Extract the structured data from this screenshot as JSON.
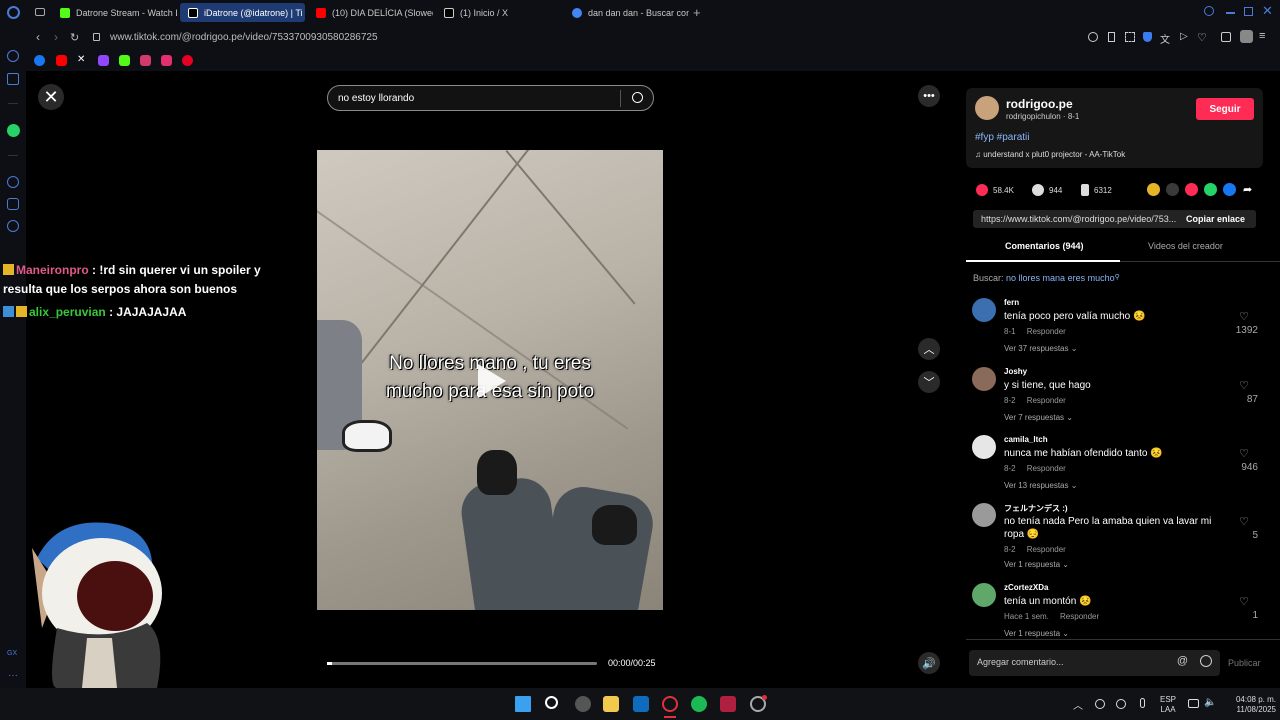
{
  "browser": {
    "tabs": [
      {
        "label": "Datrone Stream - Watch L",
        "color": "#53fc18"
      },
      {
        "label": "iDatrone (@idatrone) | Ti",
        "color": "#000000"
      },
      {
        "label": "(10) DIA DELÍCIA (Slowed",
        "color": "#ff0000"
      },
      {
        "label": "(1) Inicio / X",
        "color": "#ffffff"
      },
      {
        "label": "dan dan dan - Buscar con",
        "color": "#4285f4"
      }
    ],
    "url": "www.tiktok.com/@rodrigoo.pe/video/7533700930580286725"
  },
  "video": {
    "search_text": "no estoy llorando",
    "caption_line1": "No llores mano , tu eres",
    "caption_line2": "mucho para esa sin poto",
    "time": "00:00/00:25",
    "progress": 0.02
  },
  "chat": [
    {
      "user": "Maneironpro",
      "text": ": !rd sin querer vi un spoiler y",
      "text2": "resulta que los serpos ahora son buenos"
    },
    {
      "user": "alix_peruvian",
      "text": ": JAJAJAJAA"
    }
  ],
  "creator": {
    "name": "rodrigoo.pe",
    "handle": "rodrigopichulon · 8-1",
    "follow_label": "Seguir",
    "hashtags": "#fyp #paratii",
    "music": "♫  understand x plut0 projector - AA-TikTok"
  },
  "stats": {
    "likes": "58.4K",
    "comments": "944",
    "saves": "6312"
  },
  "link": {
    "url": "https://www.tiktok.com/@rodrigoo.pe/video/753...",
    "copy_label": "Copiar enlace"
  },
  "tabs": {
    "comments": "Comentarios (944)",
    "videos": "Videos del creador"
  },
  "search_suggest": {
    "prefix": "Buscar:",
    "query": "no llores mana eres mucho"
  },
  "comments": [
    {
      "user": "fern",
      "text": "tenía poco pero valía mucho 😣",
      "date": "8-1",
      "reply": "Responder",
      "replies": "Ver 37 respuestas ⌄",
      "likes": "1392",
      "avatar": "#3a6fb0"
    },
    {
      "user": "Joshy",
      "text": "y si tiene, que hago",
      "date": "8-2",
      "reply": "Responder",
      "replies": "Ver 7 respuestas ⌄",
      "likes": "87",
      "avatar": "#8a6a5a"
    },
    {
      "user": "camila_ltch",
      "text": "nunca me habían ofendido tanto 😣",
      "date": "8-2",
      "reply": "Responder",
      "replies": "Ver 13 respuestas ⌄",
      "likes": "946",
      "avatar": "#e6e6e6"
    },
    {
      "user": "フェルナンデス :)",
      "text": "no tenía nada Pero la amaba quien va lavar mi ropa 😔",
      "date": "8-2",
      "reply": "Responder",
      "replies": "Ver 1 respuesta ⌄",
      "likes": "5",
      "avatar": "#9a9a9a"
    },
    {
      "user": "zCortezXDa",
      "text": "tenía un montón 😣",
      "date": "Hace 1 sem.",
      "reply": "Responder",
      "replies": "Ver 1 respuesta ⌄",
      "likes": "1",
      "avatar": "#5fa86a"
    }
  ],
  "add_comment": {
    "placeholder": "Agregar comentario...",
    "publish": "Publicar"
  },
  "taskbar": {
    "lang1": "ESP",
    "lang2": "LAA",
    "time": "04:08 p. m.",
    "date": "11/08/2025"
  }
}
